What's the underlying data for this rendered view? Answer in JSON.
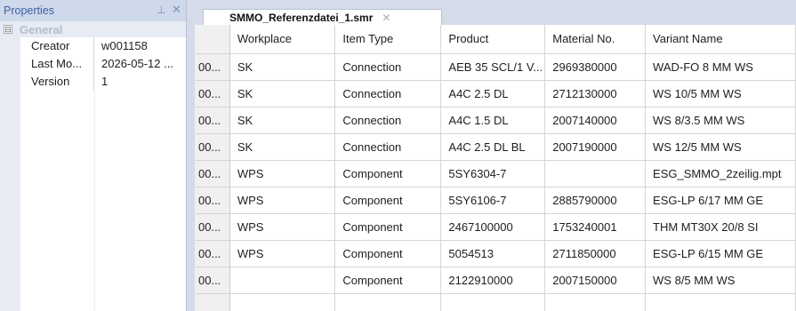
{
  "properties_panel": {
    "title": "Properties",
    "pin_icon": "pin-icon",
    "close_icon": "close-icon",
    "group": {
      "label": "General",
      "toggle": "⊟"
    },
    "rows": [
      {
        "name": "Creator",
        "value": "w001158"
      },
      {
        "name": "Last Mo...",
        "value": "2026-05-12 ..."
      },
      {
        "name": "Version",
        "value": "1"
      }
    ]
  },
  "document_tab": {
    "label": "SMMO_Referenzdatei_1.smr",
    "close": "✕"
  },
  "grid": {
    "columns": [
      "Workplace",
      "Item Type",
      "Product",
      "Material No.",
      "Variant Name"
    ],
    "rows": [
      {
        "id": "00...",
        "workplace": "SK",
        "item_type": "Connection",
        "product": "AEB 35 SCL/1 V...",
        "material": "2969380000",
        "variant": "WAD-FO 8 MM WS"
      },
      {
        "id": "00...",
        "workplace": "SK",
        "item_type": "Connection",
        "product": "A4C 2.5 DL",
        "material": "2712130000",
        "variant": "WS 10/5 MM WS"
      },
      {
        "id": "00...",
        "workplace": "SK",
        "item_type": "Connection",
        "product": "A4C 1.5 DL",
        "material": "2007140000",
        "variant": "WS 8/3.5 MM WS"
      },
      {
        "id": "00...",
        "workplace": "SK",
        "item_type": "Connection",
        "product": "A4C 2.5 DL BL",
        "material": "2007190000",
        "variant": "WS 12/5 MM WS"
      },
      {
        "id": "00...",
        "workplace": "WPS",
        "item_type": "Component",
        "product": "5SY6304-7",
        "material": "",
        "variant": "ESG_SMMO_2zeilig.mpt"
      },
      {
        "id": "00...",
        "workplace": "WPS",
        "item_type": "Component",
        "product": "5SY6106-7",
        "material": "2885790000",
        "variant": "ESG-LP 6/17 MM GE"
      },
      {
        "id": "00...",
        "workplace": "WPS",
        "item_type": "Component",
        "product": "2467100000",
        "material": "1753240001",
        "variant": "THM MT30X 20/8 SI"
      },
      {
        "id": "00...",
        "workplace": "WPS",
        "item_type": "Component",
        "product": "5054513",
        "material": "2711850000",
        "variant": "ESG-LP 6/15 MM GE"
      },
      {
        "id": "00...",
        "workplace": "",
        "item_type": "Component",
        "product": "2122910000",
        "material": "2007150000",
        "variant": "WS 8/5 MM WS"
      },
      {
        "id": "",
        "workplace": "",
        "item_type": "",
        "product": "",
        "material": "",
        "variant": ""
      }
    ]
  }
}
